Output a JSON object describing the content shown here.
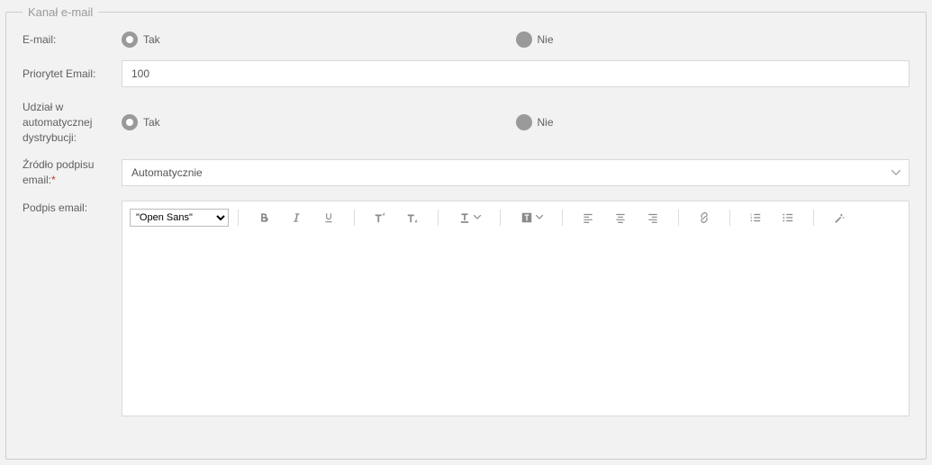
{
  "fieldset": {
    "legend": "Kanał e-mail"
  },
  "email": {
    "label": "E-mail:",
    "yes": "Tak",
    "no": "Nie",
    "value": "Tak"
  },
  "priority": {
    "label": "Priorytet Email:",
    "value": "100"
  },
  "distribution": {
    "label": "Udział w automatycznej dystrybucji:",
    "yes": "Tak",
    "no": "Nie",
    "value": "Tak"
  },
  "signature_source": {
    "label": "Źródło podpisu email:",
    "required": "*",
    "value": "Automatycznie"
  },
  "signature": {
    "label": "Podpis email:",
    "font_option": "\"Open Sans\"",
    "content": ""
  },
  "colors": {
    "border": "#d9d9d9",
    "icon": "#8a8a8a"
  }
}
